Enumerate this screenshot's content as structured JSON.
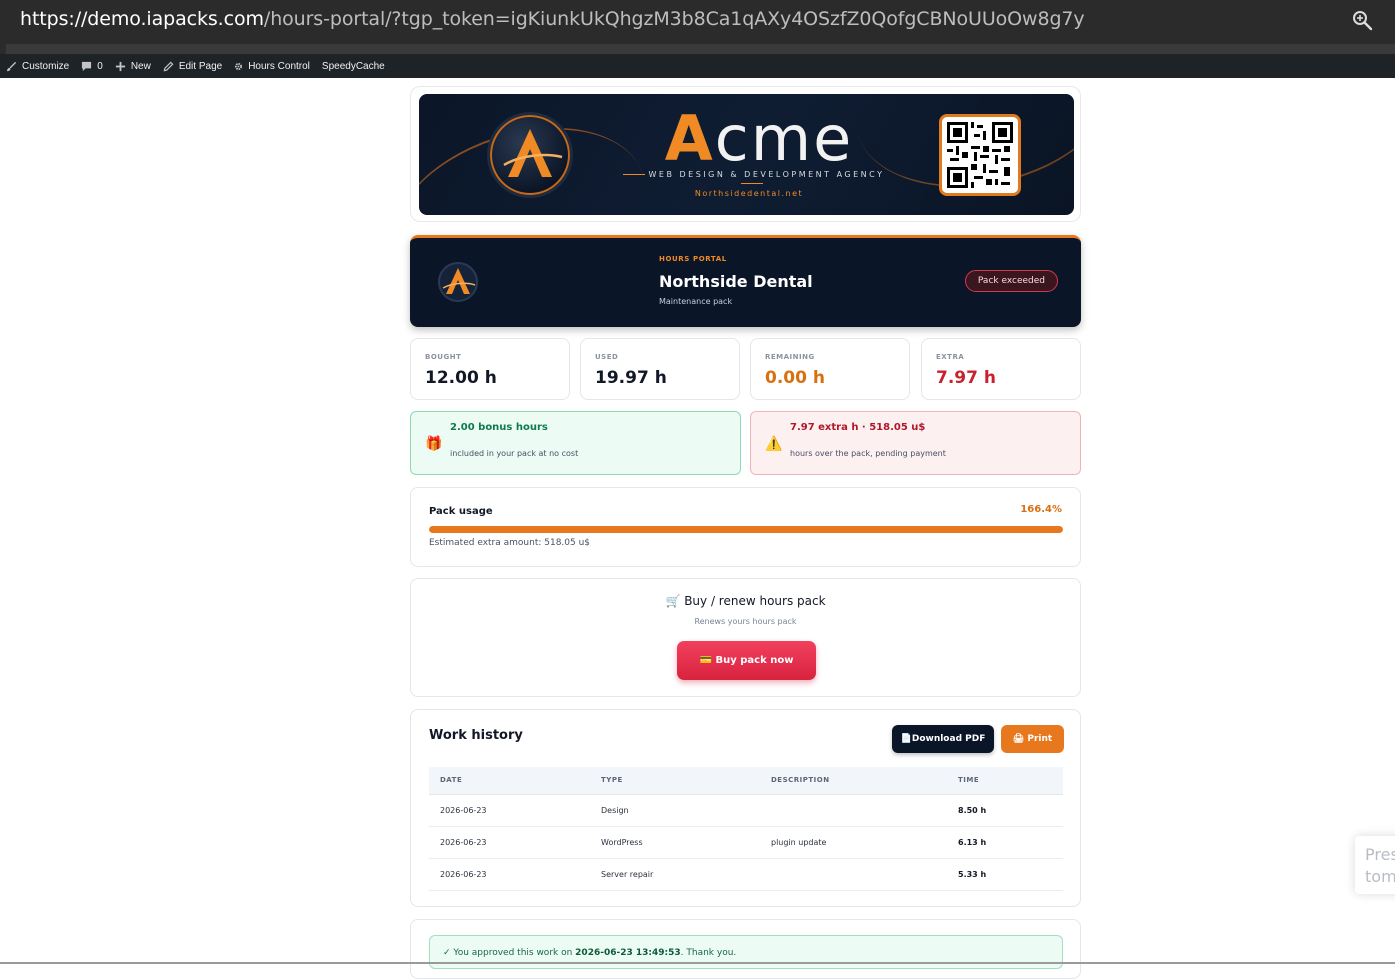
{
  "browser": {
    "url_host": "https://demo.iapacks.com",
    "url_rest": "/hours-portal/?tgp_token=igKiunkUkQhgzM3b8Ca1qAXy4OSzfZ0QofgCBNoUUoOw8g7y",
    "zoom_icon": "zoom-icon"
  },
  "adminbar": {
    "items": [
      {
        "label": "Customize",
        "icon": "brush-icon"
      },
      {
        "label": "0",
        "icon": "comment-icon"
      },
      {
        "label": "New",
        "icon": "plus-icon"
      },
      {
        "label": "Edit Page",
        "icon": "pencil-icon"
      },
      {
        "label": "Hours Control",
        "icon": "gear-icon"
      },
      {
        "label": "SpeedyCache",
        "icon": ""
      }
    ]
  },
  "banner": {
    "brand_a": "A",
    "brand_rest": "cme",
    "tagline": "WEB DESIGN & DEVELOPMENT AGENCY",
    "site": "Northsidedental.net"
  },
  "header": {
    "kicker": "HOURS PORTAL",
    "client": "Northside Dental",
    "plan": "Maintenance pack",
    "status_badge": "Pack exceeded"
  },
  "stats": [
    {
      "label": "BOUGHT",
      "value": "12.00 h",
      "color": "#121826"
    },
    {
      "label": "USED",
      "value": "19.97 h",
      "color": "#121826"
    },
    {
      "label": "REMAINING",
      "value": "0.00 h",
      "color": "#d8700f"
    },
    {
      "label": "EXTRA",
      "value": "7.97 h",
      "color": "#c8222e"
    }
  ],
  "notices": {
    "bonus": {
      "title": "2.00 bonus hours",
      "text": "included in your pack at no cost",
      "icon": "🎁"
    },
    "extra": {
      "title": "7.97 extra h · 518.05 u$",
      "text": "hours over the pack, pending payment",
      "icon": "⚠️"
    }
  },
  "usage": {
    "title": "Pack usage",
    "percent": "166.4%",
    "fill_fraction": 1.0,
    "estimate": "Estimated extra amount: 518.05 u$"
  },
  "buy": {
    "title": "🛒 Buy / renew hours pack",
    "subtitle": "Renews yours hours pack",
    "button": "💳 Buy pack now"
  },
  "history": {
    "title": "Work history",
    "pdf_button": "📄Download PDF",
    "print_button": "🖨 Print",
    "columns": [
      "DATE",
      "TYPE",
      "DESCRIPTION",
      "TIME"
    ],
    "rows": [
      {
        "date": "2026-06-23",
        "type": "Design",
        "description": "",
        "time": "8.50 h"
      },
      {
        "date": "2026-06-23",
        "type": "WordPress",
        "description": "plugin update",
        "time": "6.13 h"
      },
      {
        "date": "2026-06-23",
        "type": "Server repair",
        "description": "",
        "time": "5.33 h"
      }
    ]
  },
  "approval": {
    "prefix": "✓ You approved this work on ",
    "datetime": "2026-06-23 13:49:53",
    "suffix": ". Thank you."
  },
  "toast": {
    "line1": "Pres",
    "line2": "tom"
  },
  "colors": {
    "accent": "#e8781e",
    "navy": "#0b1528",
    "danger": "#c8222e",
    "success": "#17694a"
  }
}
